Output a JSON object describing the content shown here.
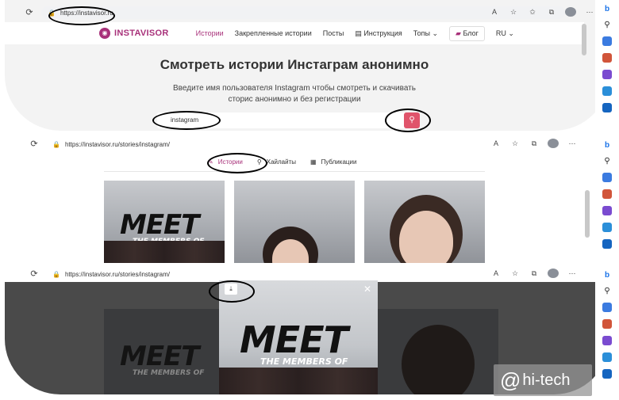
{
  "panel1": {
    "url": "https://instavisor.ru",
    "logo": "INSTAVISOR",
    "nav": [
      "Истории",
      "Закрепленные истории",
      "Посты",
      "Инструкция",
      "Топы",
      "Блог",
      "RU"
    ],
    "title": "Смотреть истории Инстаграм анонимно",
    "subtitle_line1": "Введите имя пользователя Instagram чтобы смотреть и скачивать",
    "subtitle_line2": "сторис анонимно и без регистрации",
    "search_value": "instagram"
  },
  "panel2": {
    "url": "https://instavisor.ru/stories/instagram/",
    "tabs": [
      "Истории",
      "Хайлайты",
      "Публикации"
    ],
    "card_meet": "MEET",
    "card_members": "THE MEMBERS OF"
  },
  "panel3": {
    "url": "https://instavisor.ru/stories/instagram/",
    "modal_meet": "MEET",
    "modal_members": "THE MEMBERS OF",
    "bg_meet": "MEET",
    "bg_members": "THE MEMBERS OF"
  },
  "watermark": {
    "at": "@",
    "text": "hi-tech"
  },
  "colors": {
    "brand": "#a8317a",
    "search_button": "#e0546b"
  },
  "icons": {
    "reload": "reload-icon",
    "lock": "lock-icon",
    "search": "search-icon",
    "download": "download-icon",
    "close": "close-icon"
  }
}
